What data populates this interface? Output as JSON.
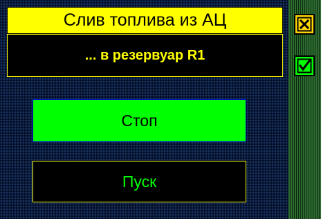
{
  "dialog": {
    "title": "Слив топлива из АЦ",
    "subtitle": "... в резервуар R1"
  },
  "buttons": {
    "stop_label": "Стоп",
    "start_label": "Пуск"
  },
  "side_controls": {
    "close_icon": "close-x-icon",
    "confirm_icon": "checkmark-icon"
  },
  "colors": {
    "title_background": "#ffff00",
    "panel_background": "#000000",
    "accent_text": "#ffff00",
    "active_button": "#00ff00",
    "start_text": "#00ff00",
    "close_button": "#ffd700",
    "confirm_button": "#00ff00"
  }
}
